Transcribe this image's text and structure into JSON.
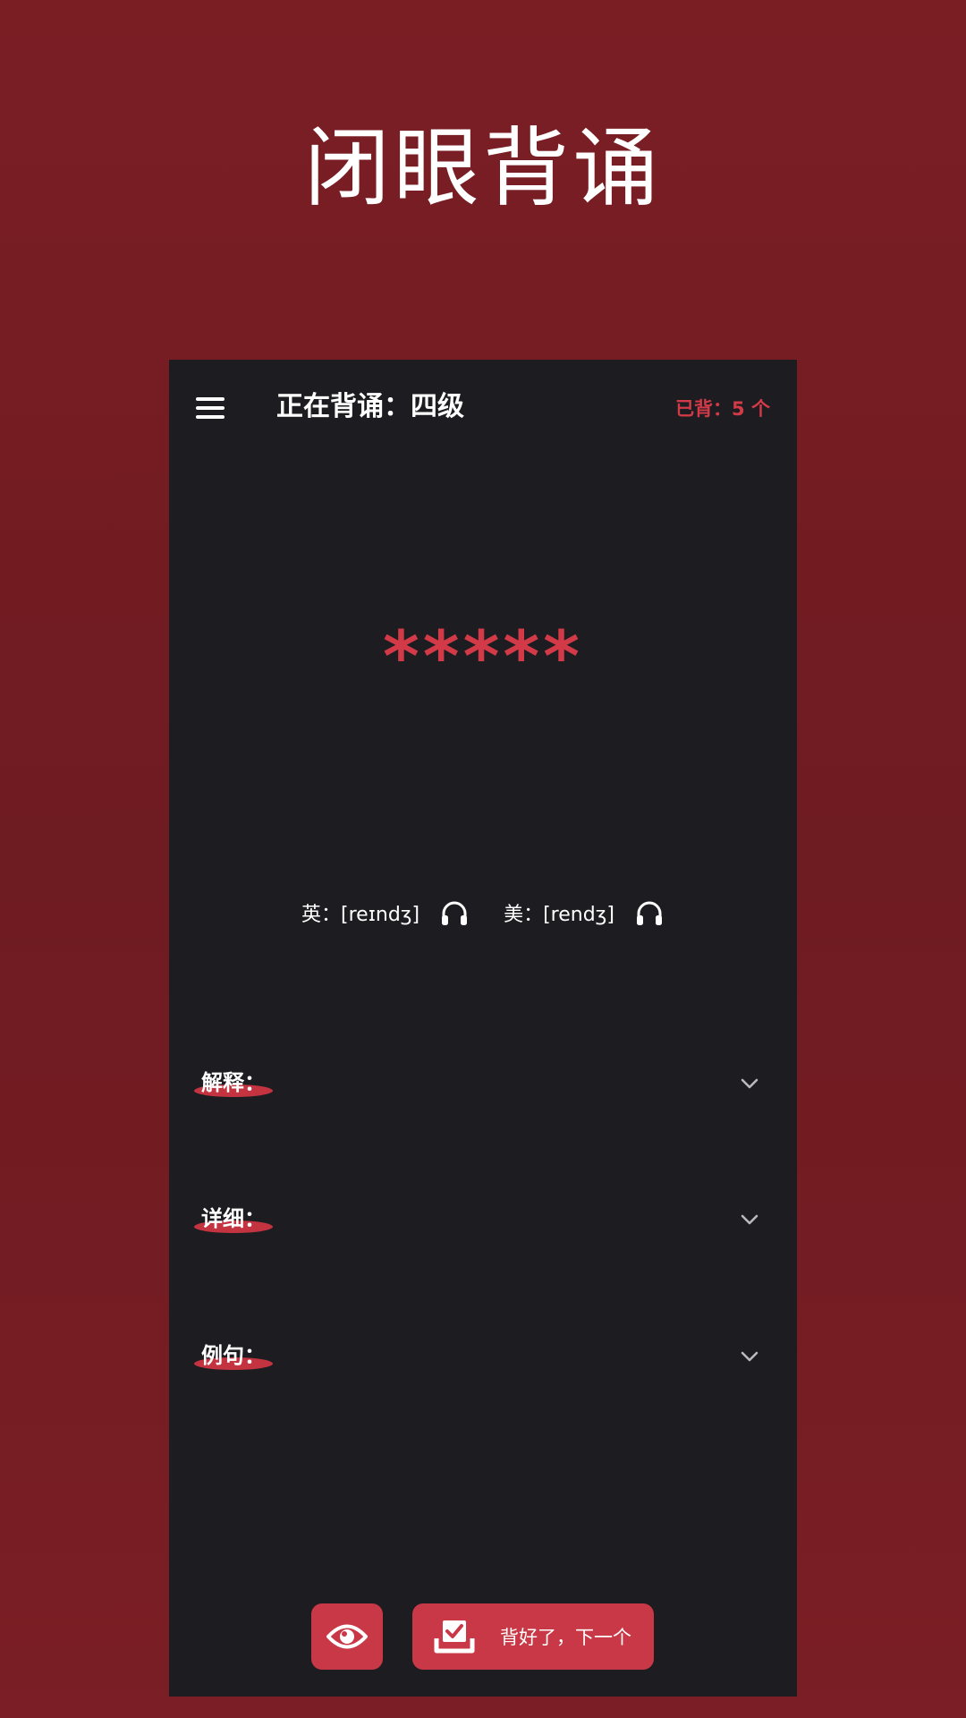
{
  "page": {
    "heading": "闭眼背诵"
  },
  "header": {
    "title": "正在背诵：四级",
    "progress": "已背：5 个"
  },
  "word": {
    "masked": "*****"
  },
  "pronunciation": {
    "uk": "英：[reɪndʒ]",
    "us": "美：[rendʒ]"
  },
  "sections": [
    {
      "label": "解释："
    },
    {
      "label": "详细："
    },
    {
      "label": "例句："
    }
  ],
  "actions": {
    "next_label": "背好了，下一个"
  },
  "colors": {
    "accent": "#c93846",
    "background": "#7a1e24",
    "card": "#1d1c21"
  },
  "icons": {
    "menu": "menu-icon",
    "headphone": "headphone-icon",
    "chevron": "chevron-down-icon",
    "eye": "eye-icon",
    "done": "checkbox-tray-icon"
  }
}
